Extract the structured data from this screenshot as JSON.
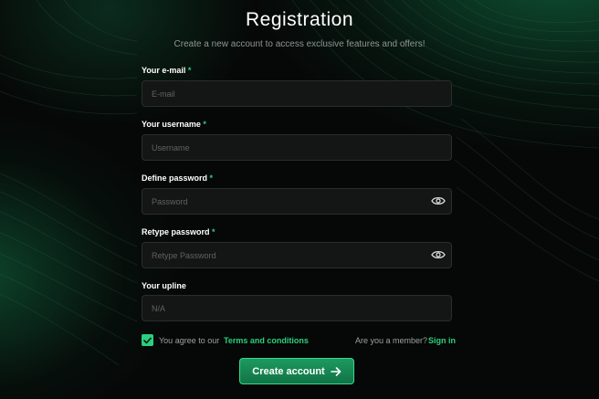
{
  "header": {
    "title": "Registration",
    "subtitle": "Create a new account to access exclusive features and offers!"
  },
  "form": {
    "required_mark": "*",
    "email": {
      "label": "Your e-mail",
      "placeholder": "E-mail",
      "value": ""
    },
    "username": {
      "label": "Your username",
      "placeholder": "Username",
      "value": ""
    },
    "password": {
      "label": "Define password",
      "placeholder": "Password",
      "value": "",
      "toggle_icon": "eye-icon"
    },
    "retype_password": {
      "label": "Retype password",
      "placeholder": "Retype Password",
      "value": "",
      "toggle_icon": "eye-icon"
    },
    "upline": {
      "label": "Your upline",
      "placeholder": "N/A",
      "value": ""
    }
  },
  "agreement": {
    "checked": true,
    "text": "You agree to our",
    "terms_link": "Terms and conditions"
  },
  "member": {
    "text": "Are you a member?",
    "signin_link": "Sign in"
  },
  "submit": {
    "label": "Create account",
    "icon": "arrow-right-icon"
  },
  "colors": {
    "accent": "#2ad07f",
    "button_bg": "#167f4f",
    "background": "#060807",
    "field_bg": "#141615"
  }
}
